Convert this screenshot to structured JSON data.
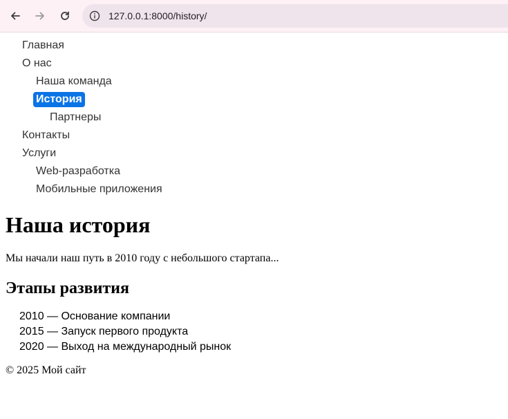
{
  "browser": {
    "url": "127.0.0.1:8000/history/",
    "icons": {
      "back": "arrow-left-icon",
      "forward": "arrow-right-icon",
      "reload": "reload-icon",
      "site_info": "info-icon"
    }
  },
  "nav": {
    "items": [
      {
        "label": "Главная"
      },
      {
        "label": "О нас"
      },
      {
        "label": "Наша команда"
      },
      {
        "label": "История",
        "active": true
      },
      {
        "label": "Партнеры"
      },
      {
        "label": "Контакты"
      },
      {
        "label": "Услуги"
      },
      {
        "label": "Web-разработка"
      },
      {
        "label": "Мобильные приложения"
      }
    ],
    "active_color": "#0a74e6"
  },
  "main": {
    "title": "Наша история",
    "intro": "Мы начали наш путь в 2010 году с небольшого стартапа...",
    "milestones_title": "Этапы развития",
    "milestones": [
      "2010 — Основание компании",
      "2015 — Запуск первого продукта",
      "2020 — Выход на международный рынок"
    ]
  },
  "footer": {
    "text": "© 2025 Мой сайт"
  }
}
